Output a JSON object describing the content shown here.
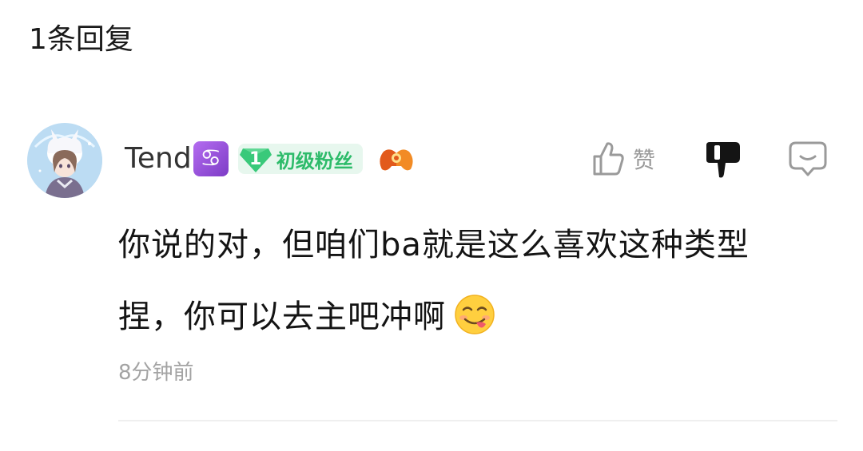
{
  "header": {
    "reply_count": "1条回复"
  },
  "comment": {
    "username": "Tend",
    "zodiac_glyph": "♋",
    "zodiac_icon": "cancer-zodiac-icon",
    "fan_badge": {
      "level": "1",
      "label": "初级粉丝",
      "color": "#2dbb6a"
    },
    "body_line1": "你说的对，但咱们ba就是这么喜欢这种类型",
    "body_line2": "捏，你可以去主吧冲啊",
    "emoji": "yum-face-emoji",
    "timestamp": "8分钟前",
    "actions": {
      "like_label": "赞",
      "like_icon": "thumbs-up-icon",
      "dislike_icon": "thumbs-down-icon",
      "reply_icon": "comment-bubble-icon"
    }
  }
}
